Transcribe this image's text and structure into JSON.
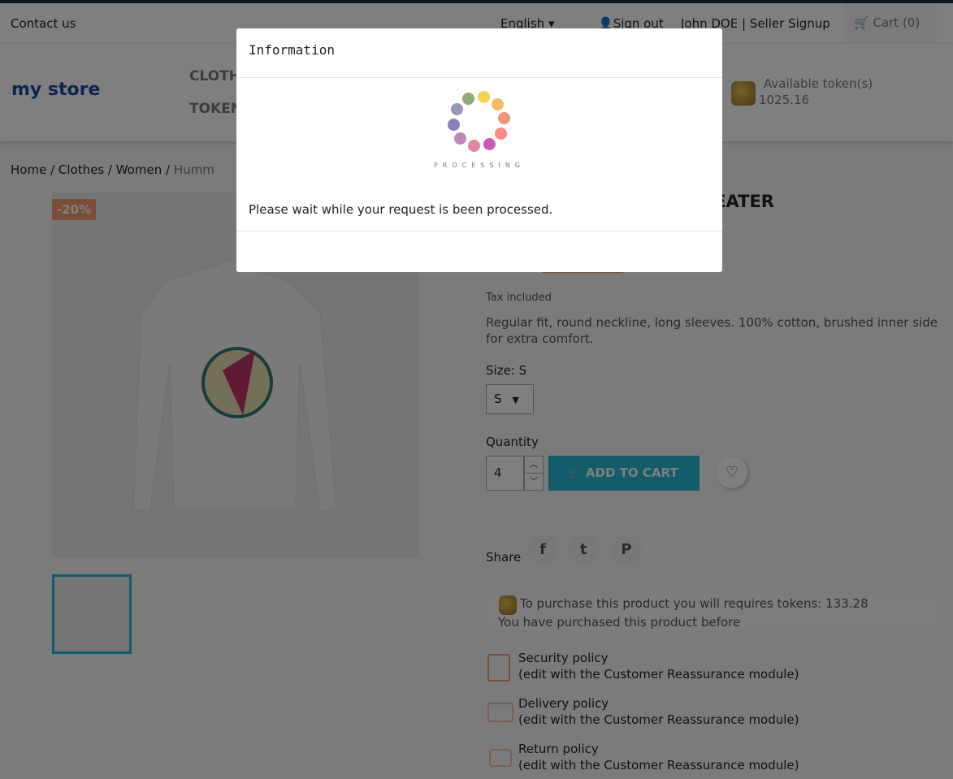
{
  "topbar": {
    "contact": "Contact us",
    "language": "English",
    "sign_out": "Sign out",
    "user": "John DOE | Seller Signup",
    "cart": "Cart (0)"
  },
  "header": {
    "logo": "my store",
    "menu": [
      "CLOTH",
      "TOKEN"
    ],
    "tokens_label": "Available token(s)",
    "tokens_value": "1025.16"
  },
  "breadcrumb": [
    "Home",
    "Clothes",
    "Women",
    "Humm"
  ],
  "product": {
    "title_partial": "WEATER",
    "discount": "-20%",
    "tax": "Tax included",
    "description": "Regular fit, round neckline, long sleeves. 100% cotton, brushed inner side for extra comfort.",
    "size_label": "Size: S",
    "size_value": "S",
    "quantity_label": "Quantity",
    "quantity": "4",
    "add_to_cart": "ADD TO CART",
    "share": "Share",
    "token_note": "To purchase this product you will requires tokens: 133.28",
    "purchased_note": "You have purchased this product before"
  },
  "reassurance": [
    {
      "title": "Security policy",
      "sub": "(edit with the Customer Reassurance module)"
    },
    {
      "title": "Delivery policy",
      "sub": "(edit with the Customer Reassurance module)"
    },
    {
      "title": "Return policy",
      "sub": "(edit with the Customer Reassurance module)"
    }
  ],
  "modal": {
    "title": "Information",
    "spinner_label": "PROCESSING",
    "message": "Please wait while your request is been processed.",
    "spinner_colors": [
      "#f7d154",
      "#f5bb62",
      "#e9957b",
      "#fe8a80",
      "#c95bb2",
      "#e0889f",
      "#bf87ba",
      "#8583b9",
      "#9598bd",
      "#8faa72"
    ]
  },
  "colors": {
    "accent": "#24b9d7",
    "discount": "#f39d72"
  }
}
